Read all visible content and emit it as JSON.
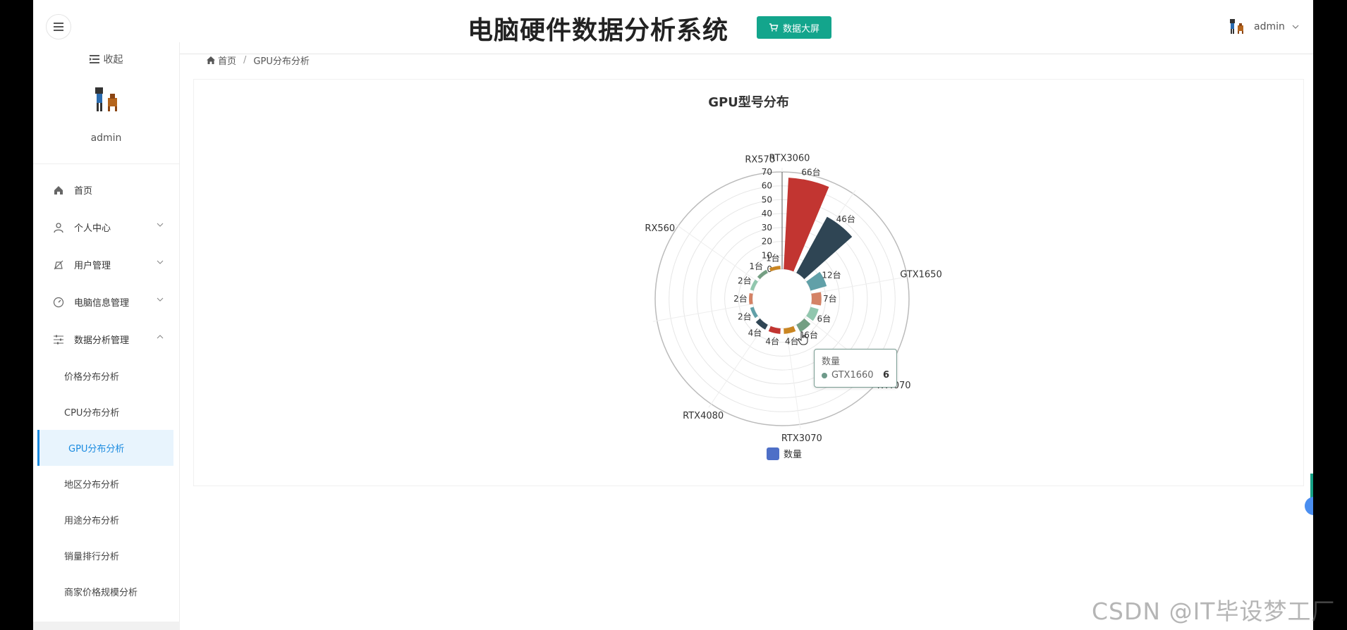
{
  "header": {
    "title": "电脑硬件数据分析系统",
    "big_screen_button": "数据大屏",
    "username": "admin"
  },
  "sidebar": {
    "collapse_label": "收起",
    "profile_name": "admin",
    "menu": [
      {
        "label": "首页",
        "icon": "home-icon"
      },
      {
        "label": "个人中心",
        "icon": "user-icon"
      },
      {
        "label": "用户管理",
        "icon": "user-manage-icon"
      },
      {
        "label": "电脑信息管理",
        "icon": "gauge-icon"
      },
      {
        "label": "数据分析管理",
        "icon": "sliders-icon"
      }
    ],
    "sub_items": [
      {
        "label": "价格分布分析"
      },
      {
        "label": "CPU分布分析"
      },
      {
        "label": "GPU分布分析",
        "active": true
      },
      {
        "label": "地区分布分析"
      },
      {
        "label": "用途分布分析"
      },
      {
        "label": "销量排行分析"
      },
      {
        "label": "商家价格规模分析"
      }
    ]
  },
  "breadcrumb": {
    "home": "首页",
    "current": "GPU分布分析"
  },
  "chart_data": {
    "type": "bar",
    "subtype": "polar-radial-bar",
    "title": "GPU型号分布",
    "categories": [
      "RTX3060",
      "GTX1650",
      "GTX1660",
      "RTX4070",
      "RTX3070",
      "RTX4080",
      "RX560",
      "RX570"
    ],
    "category_labels": [
      "RTX3060",
      "GTX1650",
      "TX4070",
      "RTX3070",
      "RTX4080",
      "RX560",
      "RX570"
    ],
    "radial_ticks": [
      "0",
      "10",
      "20",
      "30",
      "40",
      "50",
      "60",
      "70"
    ],
    "rlim": [
      0,
      70
    ],
    "series": [
      {
        "name": "数量",
        "bars": [
          {
            "label": "66台",
            "value": 66,
            "color": "#c23531"
          },
          {
            "label": "46台",
            "value": 46,
            "color": "#2f4554"
          },
          {
            "label": "12台",
            "value": 12,
            "color": "#61a0a8"
          },
          {
            "label": "7台",
            "value": 7,
            "color": "#d48265"
          },
          {
            "label": "6台",
            "value": 6,
            "color": "#91c7ae"
          },
          {
            "label": "6台",
            "value": 6,
            "color": "#749f83"
          },
          {
            "label": "4台",
            "value": 4,
            "color": "#ca8622"
          },
          {
            "label": "4台",
            "value": 4,
            "color": "#c23531"
          },
          {
            "label": "4台",
            "value": 4,
            "color": "#2f4554"
          },
          {
            "label": "2台",
            "value": 2,
            "color": "#61a0a8"
          },
          {
            "label": "2台",
            "value": 2,
            "color": "#d48265"
          },
          {
            "label": "2台",
            "value": 2,
            "color": "#91c7ae"
          },
          {
            "label": "1台",
            "value": 1,
            "color": "#749f83"
          },
          {
            "label": "1台",
            "value": 1,
            "color": "#ca8622"
          }
        ]
      }
    ],
    "legend": {
      "label": "数量",
      "color": "#4e6fc7",
      "position": "bottom"
    },
    "tooltip": {
      "title": "数量",
      "name": "GTX1660",
      "value": "6"
    }
  },
  "watermark": "CSDN @IT毕设梦工厂"
}
